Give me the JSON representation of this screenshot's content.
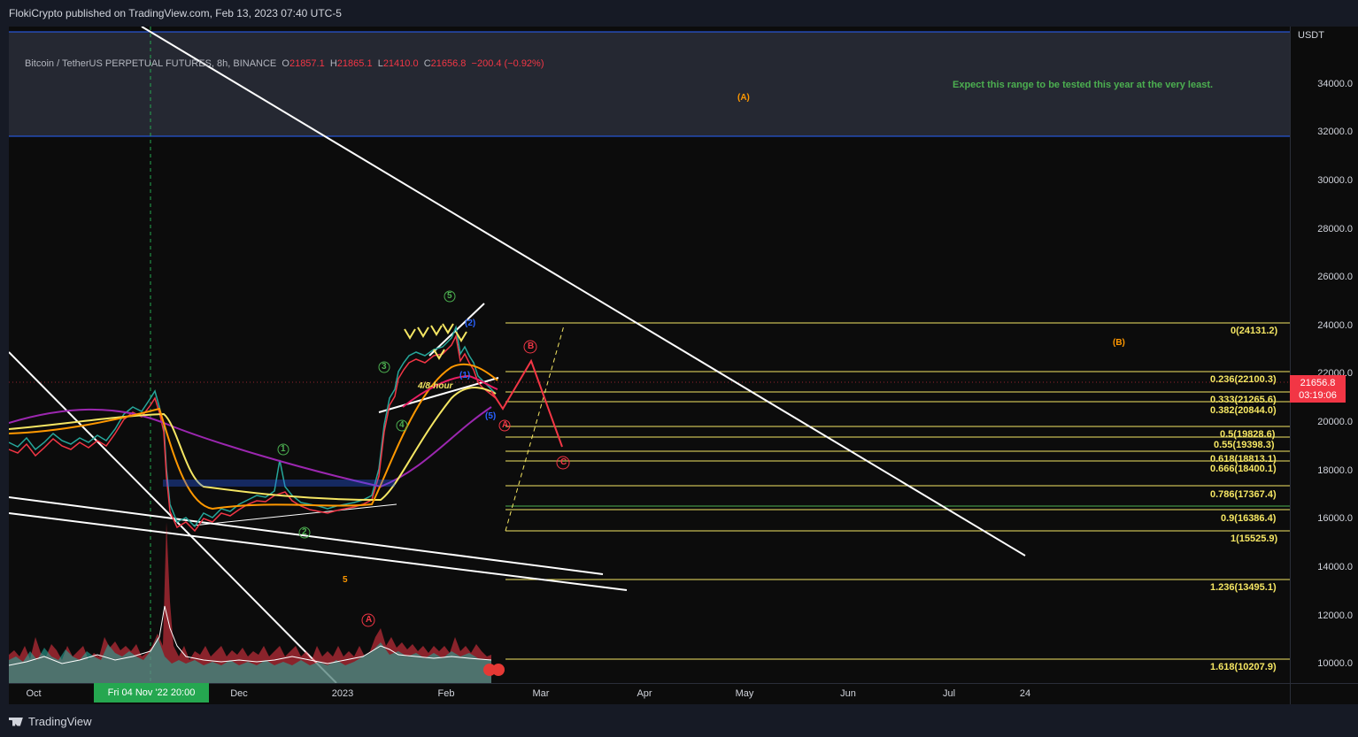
{
  "header": {
    "publish_line": "FlokiCrypto published on TradingView.com, Feb 13, 2023 07:40 UTC-5"
  },
  "legend": {
    "symbol": "Bitcoin / TetherUS PERPETUAL FUTURES, 8h, BINANCE",
    "open_label": "O",
    "open": "21857.1",
    "high_label": "H",
    "high": "21865.1",
    "low_label": "L",
    "low": "21410.0",
    "close_label": "C",
    "close": "21656.8",
    "change": "−200.4 (−0.92%)"
  },
  "price_axis": {
    "unit": "USDT",
    "ticks": [
      "34000.0",
      "32000.0",
      "30000.0",
      "28000.0",
      "26000.0",
      "24000.0",
      "22000.0",
      "20000.0",
      "18000.0",
      "16000.0",
      "14000.0",
      "12000.0",
      "10000.0"
    ],
    "current_price": "21656.8",
    "countdown": "03:19:06"
  },
  "time_axis": {
    "ticks": [
      "Oct",
      "Dec",
      "2023",
      "Feb",
      "Mar",
      "Apr",
      "May",
      "Jun",
      "Jul",
      "24"
    ],
    "crosshair_label": "Fri 04 Nov '22   20:00"
  },
  "fib_levels": [
    {
      "label": "0(24131.2)"
    },
    {
      "label": "0.236(22100.3)"
    },
    {
      "label": "0.333(21265.6)"
    },
    {
      "label": "0.382(20844.0)"
    },
    {
      "label": "0.5(19828.6)"
    },
    {
      "label": "0.55(19398.3)"
    },
    {
      "label": "0.618(18813.1)"
    },
    {
      "label": "0.666(18400.1)"
    },
    {
      "label": "0.786(17367.4)"
    },
    {
      "label": "0.9(16386.4)"
    },
    {
      "label": "1(15525.9)"
    },
    {
      "label": "1.236(13495.1)"
    },
    {
      "label": "1.618(10207.9)"
    }
  ],
  "annotations": {
    "range_note": "Expect this range to be tested this year at the very least.",
    "wave_A_top": "(A)",
    "wave_B_right": "(B)",
    "timeframe_label": "4/8-hour",
    "wave_5_orange": "5",
    "wave_1": "1",
    "wave_2": "2",
    "wave_3": "3",
    "wave_4": "4",
    "wave_5": "5",
    "corr_A": "A",
    "corr_B": "B",
    "corr_C": "C",
    "sub_1": "(1)",
    "sub_2": "(2)",
    "sub_5": "(5)"
  },
  "colors": {
    "fib": "#f5e663",
    "down": "#f23645",
    "up": "#26a69a",
    "wave_green": "#4caf50"
  },
  "footer": {
    "brand": "TradingView"
  }
}
